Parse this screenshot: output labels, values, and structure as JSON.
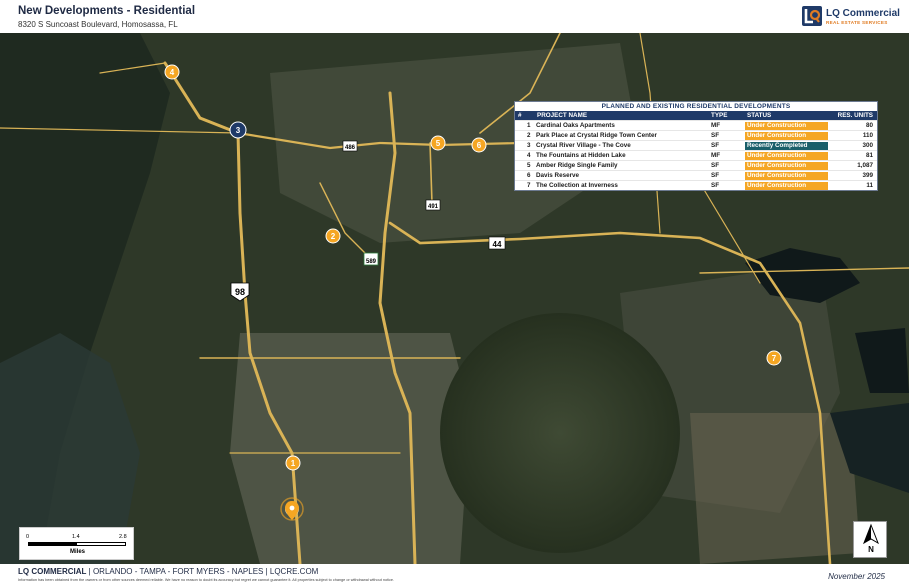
{
  "header": {
    "title": "New Developments - Residential",
    "subtitle": "8320 S Suncoast Boulevard, Homosassa, FL"
  },
  "logo": {
    "name": "LQ Commercial",
    "tagline": "REAL ESTATE SERVICES"
  },
  "map": {
    "roads": [
      "486",
      "491",
      "589",
      "44",
      "98"
    ],
    "markers": [
      "1",
      "2",
      "3",
      "4",
      "5",
      "6",
      "7"
    ],
    "subject_property": "subject-property-pin"
  },
  "table": {
    "title": "PLANNED AND EXISTING RESIDENTIAL DEVELOPMENTS",
    "headers": {
      "num": "#",
      "name": "PROJECT NAME",
      "type": "TYPE",
      "status": "STATUS",
      "units": "RES. UNITS"
    },
    "rows": [
      {
        "num": "1",
        "name": "Cardinal Oaks Apartments",
        "type": "MF",
        "status": "Under Construction",
        "units": "80"
      },
      {
        "num": "2",
        "name": "Park Place at Crystal Ridge Town Center",
        "type": "SF",
        "status": "Under Construction",
        "units": "110"
      },
      {
        "num": "3",
        "name": "Crystal River Village - The Cove",
        "type": "SF",
        "status": "Recently Completed",
        "units": "300"
      },
      {
        "num": "4",
        "name": "The Fountains at Hidden Lake",
        "type": "MF",
        "status": "Under Construction",
        "units": "81"
      },
      {
        "num": "5",
        "name": "Amber Ridge Single Family",
        "type": "SF",
        "status": "Under Construction",
        "units": "1,087"
      },
      {
        "num": "6",
        "name": "Davis Reserve",
        "type": "SF",
        "status": "Under Construction",
        "units": "399"
      },
      {
        "num": "7",
        "name": "The Collection at Inverness",
        "type": "SF",
        "status": "Under Construction",
        "units": "11"
      }
    ]
  },
  "scale": {
    "labels": [
      "0",
      "1.4",
      "2.8"
    ],
    "unit": "Miles"
  },
  "north": {
    "label": "N"
  },
  "footer": {
    "brand": "LQ COMMERCIAL",
    "offices": " | ORLANDO - TAMPA - FORT MYERS - NAPLES | LQCRE.COM",
    "disclaimer": "Information has been obtained from the owners or from other sources deemed reliable. We have no reason to doubt its accuracy but regret we cannot guarantee it. All properties subject to change or withdrawal without notice.",
    "date": "November 2025"
  },
  "colors": {
    "marker": "#f5a623",
    "marker_3": "#1f3a68",
    "road": "#d9b356",
    "under_construction": "#f5a623",
    "recently_completed": "#1a5f6a",
    "brand_navy": "#1f3a68"
  }
}
